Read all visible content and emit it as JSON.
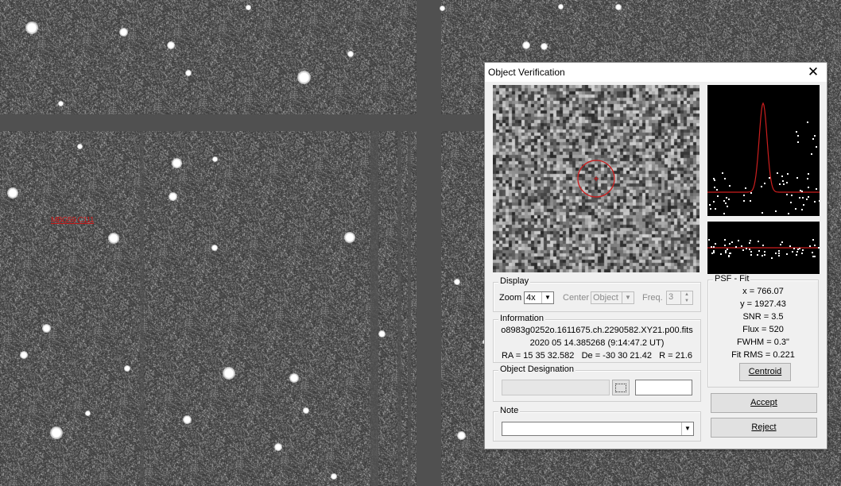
{
  "background": {
    "object_label": "MBG59 C111"
  },
  "dialog": {
    "title": "Object Verification",
    "display": {
      "group_label": "Display",
      "zoom_label": "Zoom",
      "zoom_value": "4x",
      "center_label": "Center",
      "center_value": "Object",
      "freq_label": "Freq.",
      "freq_value": "3"
    },
    "information": {
      "group_label": "Information",
      "filename": "o8983g0252o.1611675.ch.2290582.XY21.p00.fits",
      "date": "2020 05 14.385268 (9:14:47.2 UT)",
      "coords": "RA = 15 35 32.582   De = -30 30 21.42   R = 21.6"
    },
    "object_designation": {
      "group_label": "Object Designation",
      "value": "",
      "extra_value": ""
    },
    "note": {
      "group_label": "Note",
      "value": ""
    },
    "psf_fit": {
      "group_label": "PSF - Fit",
      "x": "x = 766.07",
      "y": "y = 1927.43",
      "snr": "SNR = 3.5",
      "flux": "Flux = 520",
      "fwhm": "FWHM = 0.3\"",
      "fit_rms": "Fit RMS = 0.221",
      "centroid_button": "Centroid"
    },
    "buttons": {
      "accept": "Accept",
      "reject": "Reject"
    }
  },
  "colors": {
    "dialog_bg": "#f0f0f0",
    "fit_curve": "#cc1e1e",
    "marker": "#cc1e1e"
  }
}
